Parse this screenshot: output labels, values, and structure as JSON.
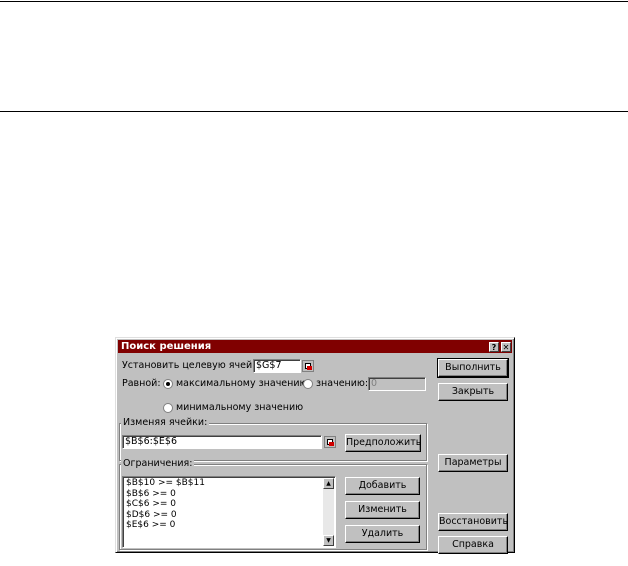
{
  "dialog": {
    "title": "Поиск решения",
    "help_glyph": "?",
    "close_glyph": "✕",
    "target_label": "Установить целевую ячейку:",
    "target_value": "$G$7",
    "equal_label": "Равной:",
    "options": {
      "max_label": "максимальному значению",
      "value_label": "значению:",
      "value_field": "0",
      "min_label": "минимальному значению",
      "selected": "max"
    },
    "changing_label": "Изменяя ячейки:",
    "changing_value": "$B$6:$E$6",
    "guess_button": "Предположить",
    "constraints_label": "Ограничения:",
    "constraints": [
      "$B$10 >= $B$11",
      "$B$6 >= 0",
      "$C$6 >= 0",
      "$D$6 >= 0",
      "$E$6 >= 0"
    ],
    "add_button": "Добавить",
    "change_button": "Изменить",
    "delete_button": "Удалить",
    "solve_button": "Выполнить",
    "close_button": "Закрыть",
    "options_button": "Параметры",
    "reset_button": "Восстановить",
    "help_button": "Справка"
  }
}
